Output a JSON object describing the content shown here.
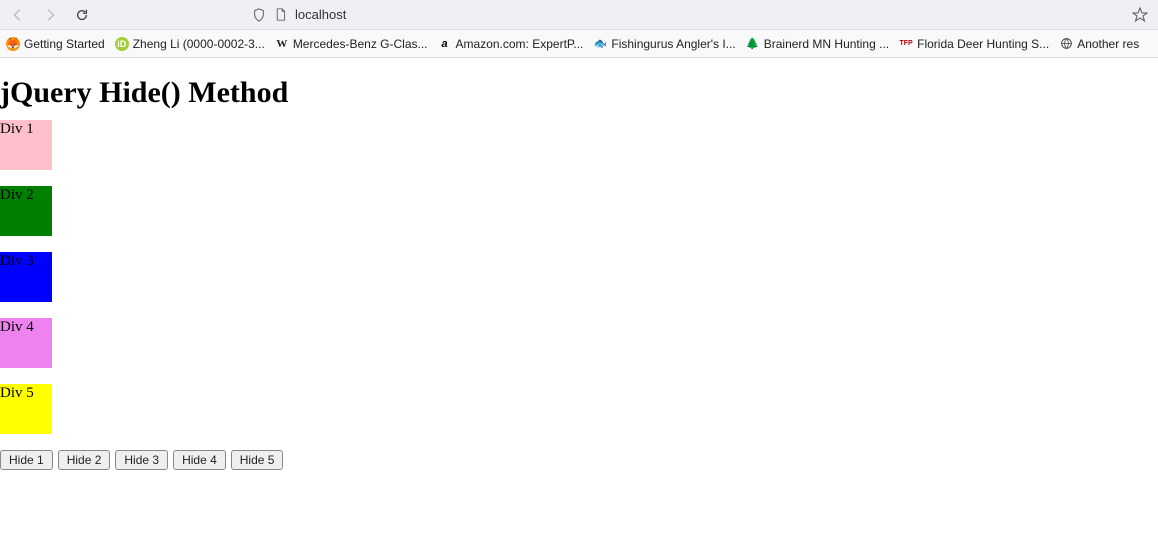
{
  "browser": {
    "url": "localhost",
    "bookmarks": [
      {
        "label": "Getting Started",
        "favicon": "firefox"
      },
      {
        "label": "Zheng Li (0000-0002-3...",
        "favicon": "orcid"
      },
      {
        "label": "Mercedes-Benz G-Clas...",
        "favicon": "w"
      },
      {
        "label": "Amazon.com: ExpertP...",
        "favicon": "amazon"
      },
      {
        "label": "Fishingurus Angler's I...",
        "favicon": "fish"
      },
      {
        "label": "Brainerd MN Hunting ...",
        "favicon": "tree"
      },
      {
        "label": "Florida Deer Hunting S...",
        "favicon": "tfp"
      },
      {
        "label": "Another res",
        "favicon": "globe"
      }
    ]
  },
  "page": {
    "heading": "jQuery Hide() Method",
    "divs": [
      {
        "label": "Div 1",
        "color": "#ffc0cb"
      },
      {
        "label": "Div 2",
        "color": "#008000"
      },
      {
        "label": "Div 3",
        "color": "#0000ff"
      },
      {
        "label": "Div 4",
        "color": "#ee82ee"
      },
      {
        "label": "Div 5",
        "color": "#ffff00"
      }
    ],
    "buttons": [
      {
        "label": "Hide 1"
      },
      {
        "label": "Hide 2"
      },
      {
        "label": "Hide 3"
      },
      {
        "label": "Hide 4"
      },
      {
        "label": "Hide 5"
      }
    ]
  }
}
